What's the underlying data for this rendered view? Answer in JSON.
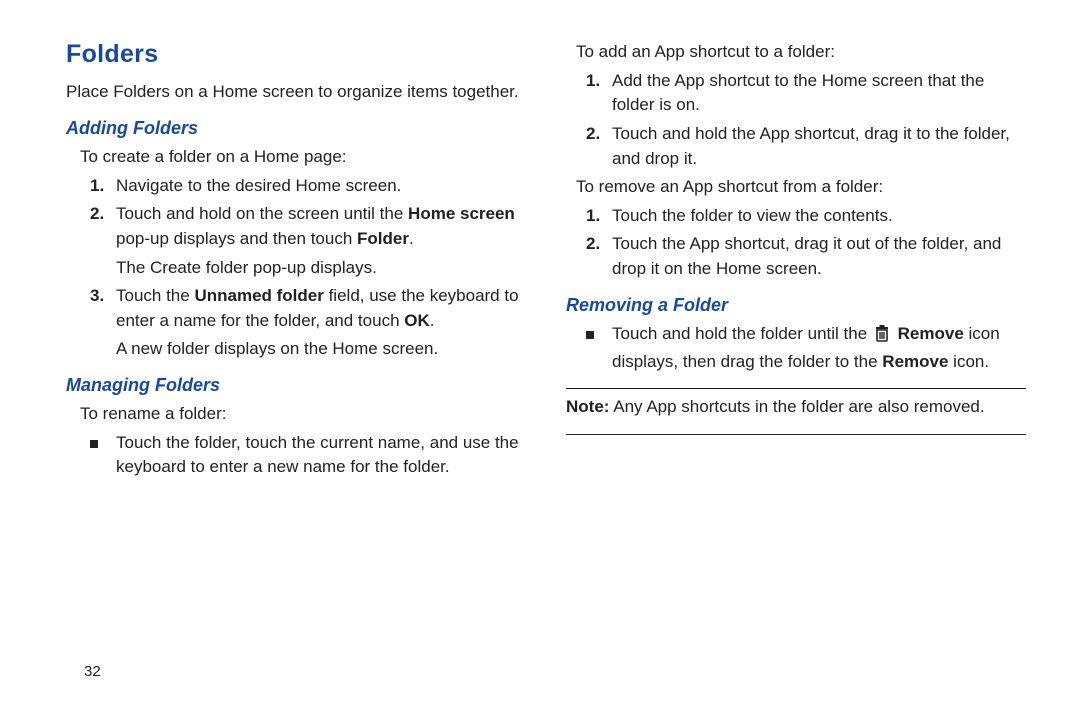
{
  "page_number": "32",
  "left": {
    "h1": "Folders",
    "intro": "Place Folders on a Home screen to organize items together.",
    "adding": {
      "h2": "Adding Folders",
      "lead": "To create a folder on a Home page:",
      "step1": "Navigate to the desired Home screen.",
      "step2_pre": "Touch and hold on the screen until the ",
      "step2_b1": "Home screen",
      "step2_mid": " pop-up displays and then touch ",
      "step2_b2": "Folder",
      "step2_post": ".",
      "step2_after": "The Create folder pop-up displays.",
      "step3_pre": "Touch the ",
      "step3_b1": "Unnamed folder",
      "step3_mid": " field, use the keyboard to enter a name for the folder, and touch ",
      "step3_b2": "OK",
      "step3_post": ".",
      "step3_after": "A new folder displays on the Home screen."
    },
    "managing": {
      "h2": "Managing Folders",
      "lead": "To rename a folder:",
      "bullet": "Touch the folder, touch the current name, and use the keyboard to enter a new name for the folder."
    }
  },
  "right": {
    "add_lead": "To add an App shortcut to a folder:",
    "add_step1": "Add the App shortcut to the Home screen that the folder is on.",
    "add_step2": "Touch and hold the App shortcut, drag it to the folder, and drop it.",
    "rem_lead": "To remove an App shortcut from a folder:",
    "rem_step1": "Touch the folder to view the contents.",
    "rem_step2": "Touch the App shortcut, drag it out of the folder, and drop it on the Home screen.",
    "removing": {
      "h2": "Removing a Folder",
      "bullet_pre": "Touch and hold the folder until the ",
      "bullet_b1": "Remove",
      "bullet_mid": " icon displays, then drag the folder to the ",
      "bullet_b2": "Remove",
      "bullet_post": " icon."
    },
    "note_b": "Note:",
    "note": " Any App shortcuts in the folder are also removed."
  },
  "nums": {
    "one": "1.",
    "two": "2.",
    "three": "3."
  }
}
